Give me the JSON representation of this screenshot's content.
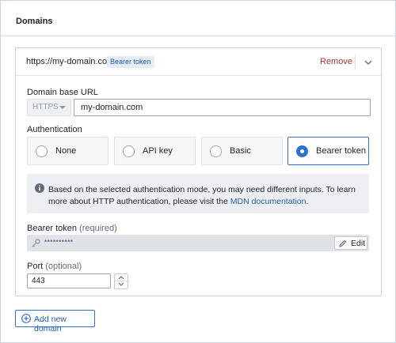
{
  "panel": {
    "title": "Domains"
  },
  "domain": {
    "url": "https://my-domain.com",
    "badge": "Bearer token",
    "remove_label": "Remove",
    "collapse_icon": "chevron-down-icon"
  },
  "base_url": {
    "label": "Domain base URL",
    "scheme": "HTTPS",
    "value": "my-domain.com"
  },
  "auth": {
    "label": "Authentication",
    "options": [
      {
        "label": "None",
        "selected": false
      },
      {
        "label": "API key",
        "selected": false
      },
      {
        "label": "Basic",
        "selected": false
      },
      {
        "label": "Bearer token",
        "selected": true
      }
    ]
  },
  "callout": {
    "icon": "info-icon",
    "text_before": "Based on the selected authentication mode, you may need different inputs. To learn more about HTTP authentication, please visit the ",
    "link_text": "MDN documentation",
    "text_after": "."
  },
  "bearer_token": {
    "label": "Bearer token",
    "hint": "(required)",
    "masked_value": "••••••••••",
    "edit_label": "Edit",
    "key_icon": "key-icon",
    "edit_icon": "pencil-icon"
  },
  "port": {
    "label": "Port",
    "hint": "(optional)",
    "value": "443"
  },
  "add_domain": {
    "label": "Add new domain",
    "icon": "plus-circle-icon"
  },
  "colors": {
    "accent": "#2d72d2",
    "link": "#215db0",
    "danger": "#ac2f33",
    "badge_bg": "#e3ecf7"
  }
}
